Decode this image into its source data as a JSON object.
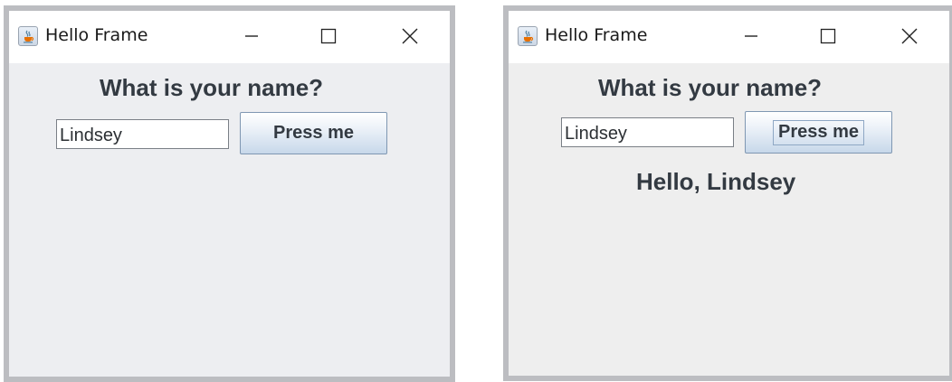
{
  "windows": [
    {
      "title": "Hello Frame",
      "question": "What is your name?",
      "name_value": "Lindsey",
      "button_label": "Press me"
    },
    {
      "title": "Hello Frame",
      "question": "What is your name?",
      "name_value": "Lindsey",
      "button_label": "Press me",
      "greeting": "Hello, Lindsey"
    }
  ],
  "icons": {
    "app": "java-app-icon",
    "minimize": "minimize-icon",
    "maximize": "maximize-icon",
    "close": "close-icon"
  },
  "colors": {
    "titlebar": "#ffffff",
    "window_border": "#bcbdc1",
    "content_background": "#edeef1",
    "text": "#333a42",
    "button_gradient_bottom": "#c7d8ea"
  }
}
